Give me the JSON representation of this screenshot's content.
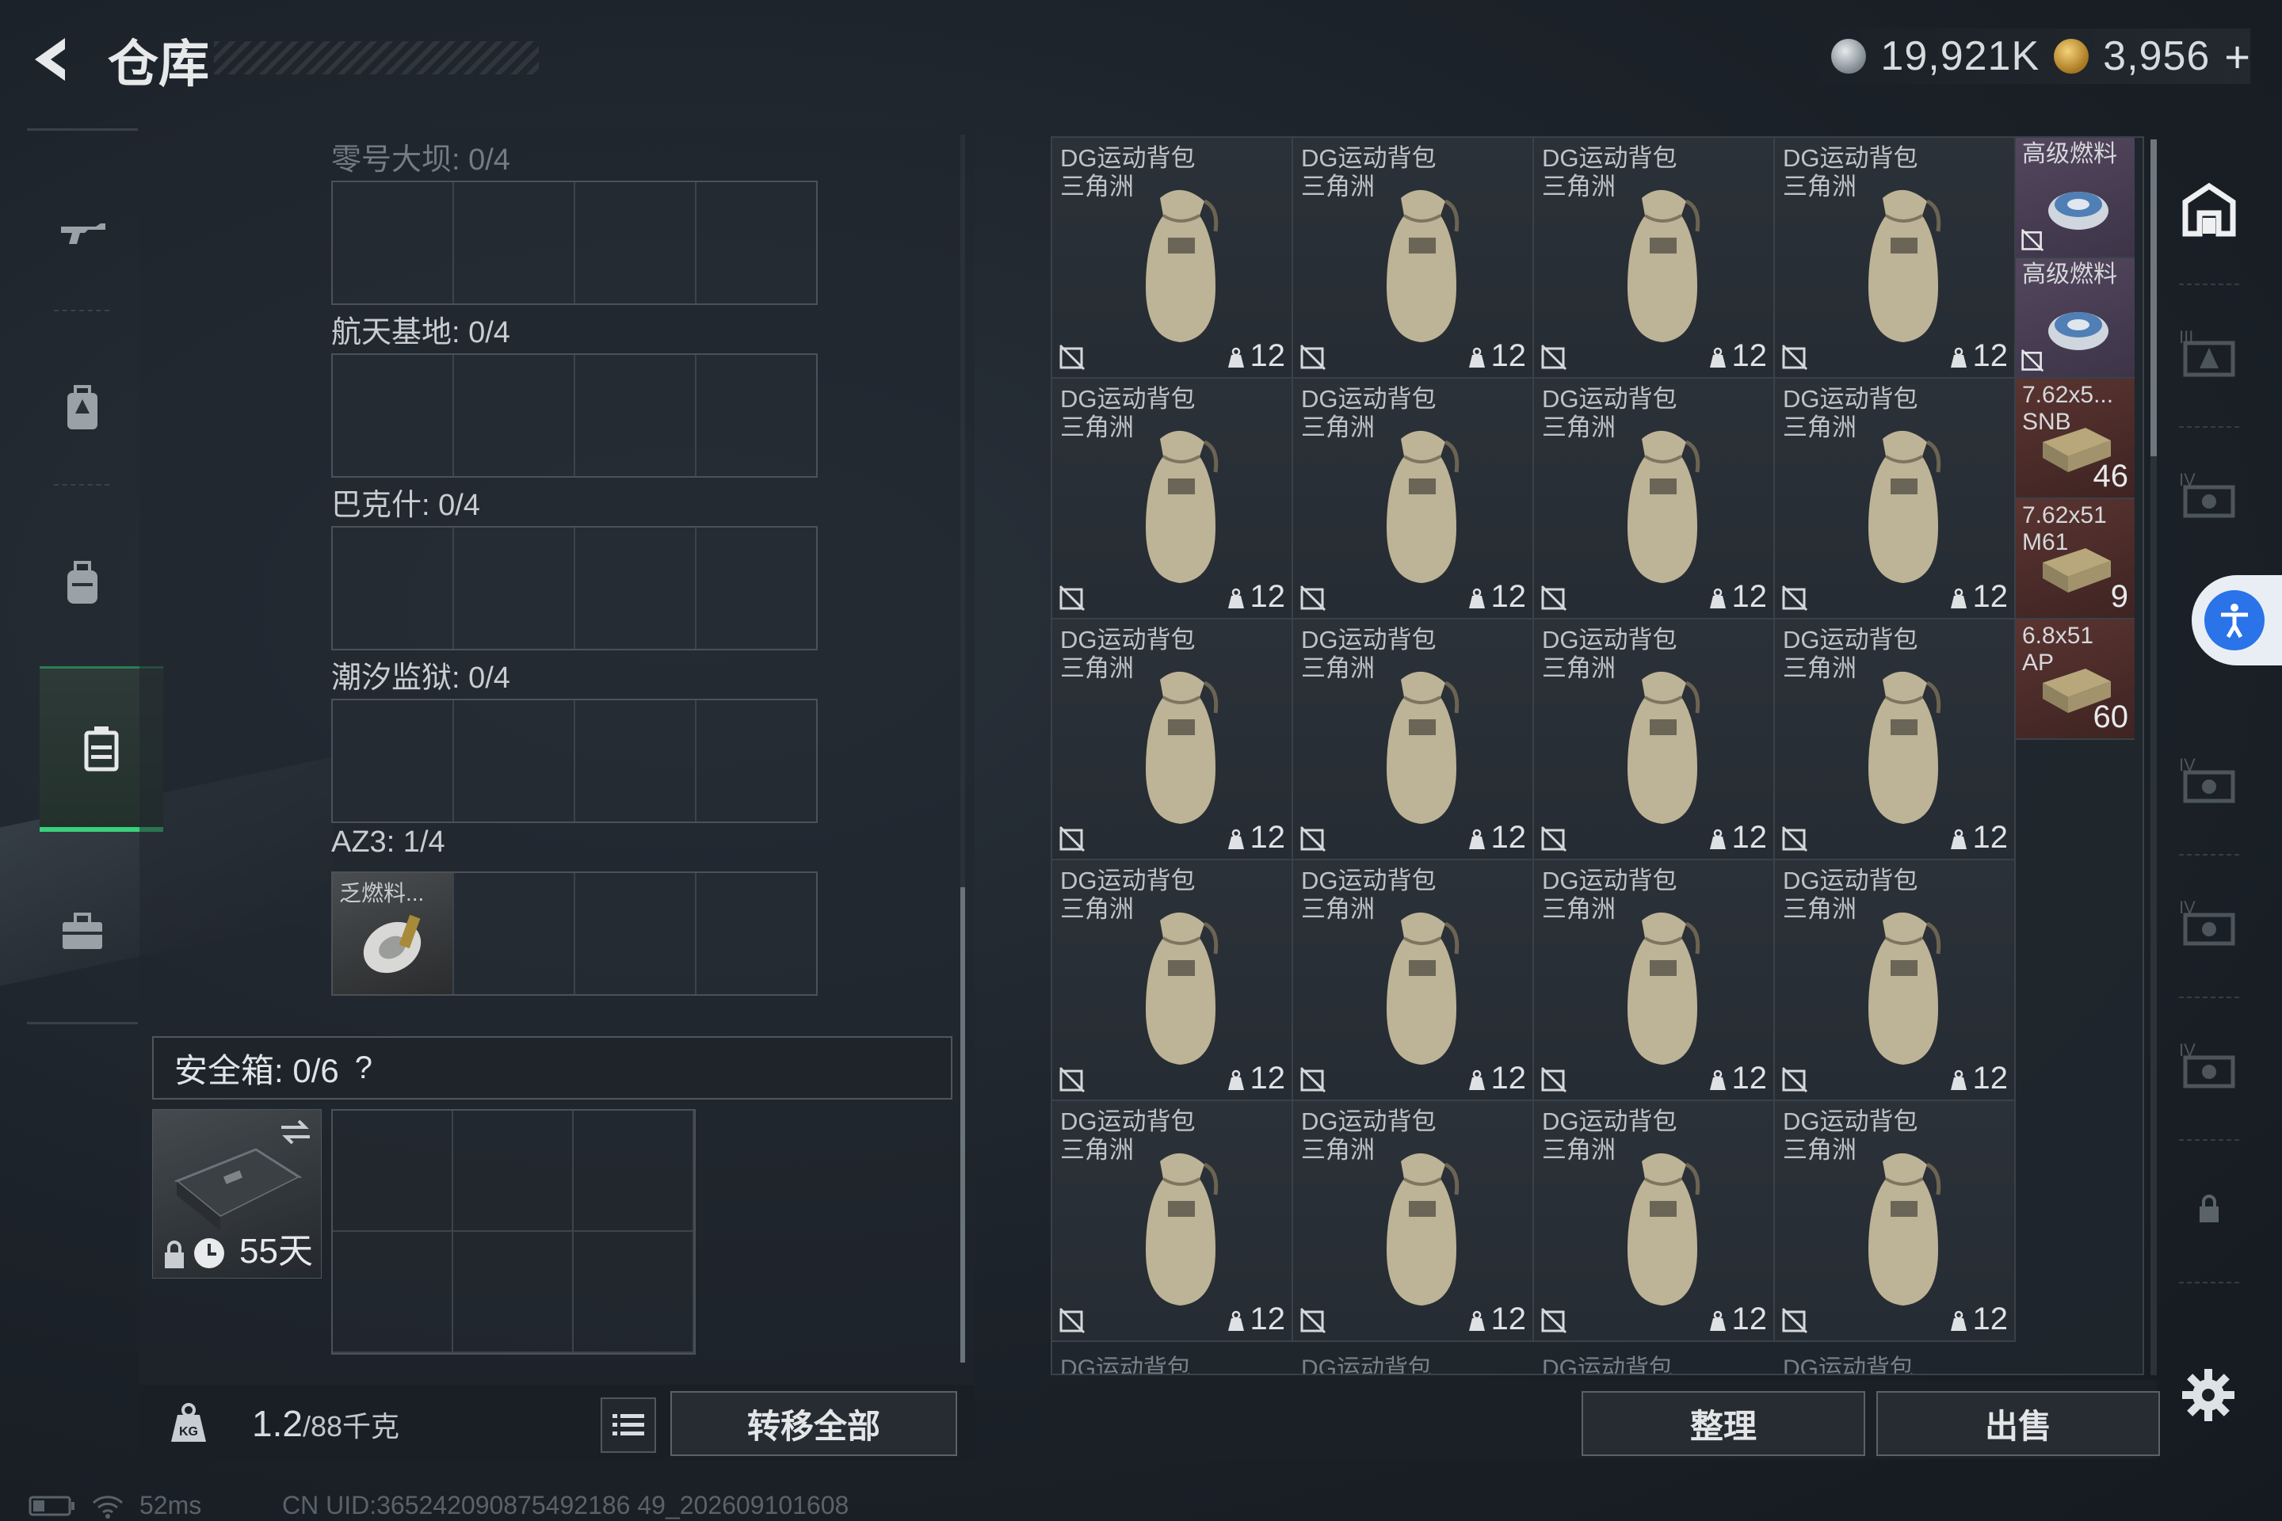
{
  "header": {
    "title": "仓库",
    "currency_silver": "19,921K",
    "currency_gold": "3,956",
    "add_label": "+"
  },
  "sidebar": {
    "items": [
      {
        "name": "weapon-icon"
      },
      {
        "name": "backpack-armor-icon"
      },
      {
        "name": "backpack-icon"
      },
      {
        "name": "container-icon",
        "active": true
      },
      {
        "name": "briefcase-icon"
      }
    ]
  },
  "map_keys": [
    {
      "label": "零号大坝: 0/4",
      "dim": true,
      "items": []
    },
    {
      "label": "航天基地: 0/4",
      "items": []
    },
    {
      "label": "巴克什: 0/4",
      "items": []
    },
    {
      "label": "潮汐监狱: 0/4",
      "items": []
    },
    {
      "label": "AZ3: 1/4",
      "items": [
        "乏燃料..."
      ]
    }
  ],
  "safe_box": {
    "label": "安全箱: 0/6",
    "help": "?",
    "days": "55天"
  },
  "footer_left": {
    "weight_value": "1.2",
    "weight_total": "/88千克",
    "transfer_all": "转移全部"
  },
  "stash": {
    "bag_name_line1": "DG运动背包",
    "bag_name_line2": "三角洲",
    "bag_count": "12",
    "bag_rows": 5,
    "bag_cols": 4,
    "side_items": [
      {
        "name": "高级燃料",
        "count": "",
        "color": "purple"
      },
      {
        "name": "高级燃料",
        "count": "",
        "color": "purple"
      },
      {
        "name": "7.62x5...",
        "name2": "SNB",
        "count": "46",
        "color": "red"
      },
      {
        "name": "7.62x51",
        "name2": "M61",
        "count": "9",
        "color": "red"
      },
      {
        "name": "6.8x51",
        "name2": "AP",
        "count": "60",
        "color": "red"
      }
    ],
    "partial_row_label": "DG运动背包"
  },
  "footer_right": {
    "sort": "整理",
    "sell": "出售"
  },
  "status": {
    "ping": "52ms",
    "uid": "CN UID:365242090875492186 49_202609101608"
  },
  "colors": {
    "accent_green": "#38d17c",
    "rare_purple": "#53475e",
    "ammo_red": "#5a3431",
    "accessibility_blue": "#2a73e8"
  }
}
